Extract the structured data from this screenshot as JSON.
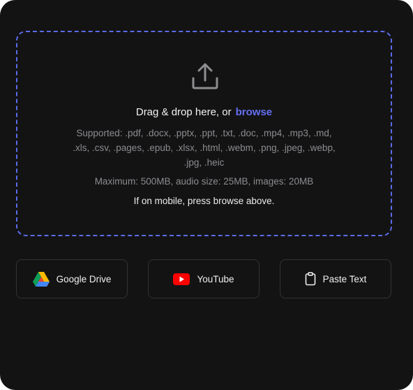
{
  "dropzone": {
    "headline_prefix": "Drag & drop here, or",
    "browse_label": "browse",
    "supported_text": "Supported: .pdf, .docx, .pptx, .ppt, .txt, .doc, .mp4, .mp3, .md, .xls, .csv, .pages, .epub, .xlsx, .html, .webm, .png, .jpeg, .webp, .jpg, .heic",
    "limits_text": "Maximum: 500MB, audio size: 25MB, images: 20MB",
    "mobile_hint": "If on mobile, press browse above."
  },
  "sources": {
    "google_drive_label": "Google Drive",
    "youtube_label": "YouTube",
    "paste_text_label": "Paste Text"
  },
  "colors": {
    "background": "#131314",
    "accent": "#6570f2",
    "dashed_border": "#5b6bea",
    "muted_text": "#8c8c8f",
    "youtube_red": "#ff0000"
  },
  "icons": {
    "upload": "upload-icon",
    "google_drive": "google-drive-icon",
    "youtube": "youtube-icon",
    "clipboard": "clipboard-icon"
  }
}
